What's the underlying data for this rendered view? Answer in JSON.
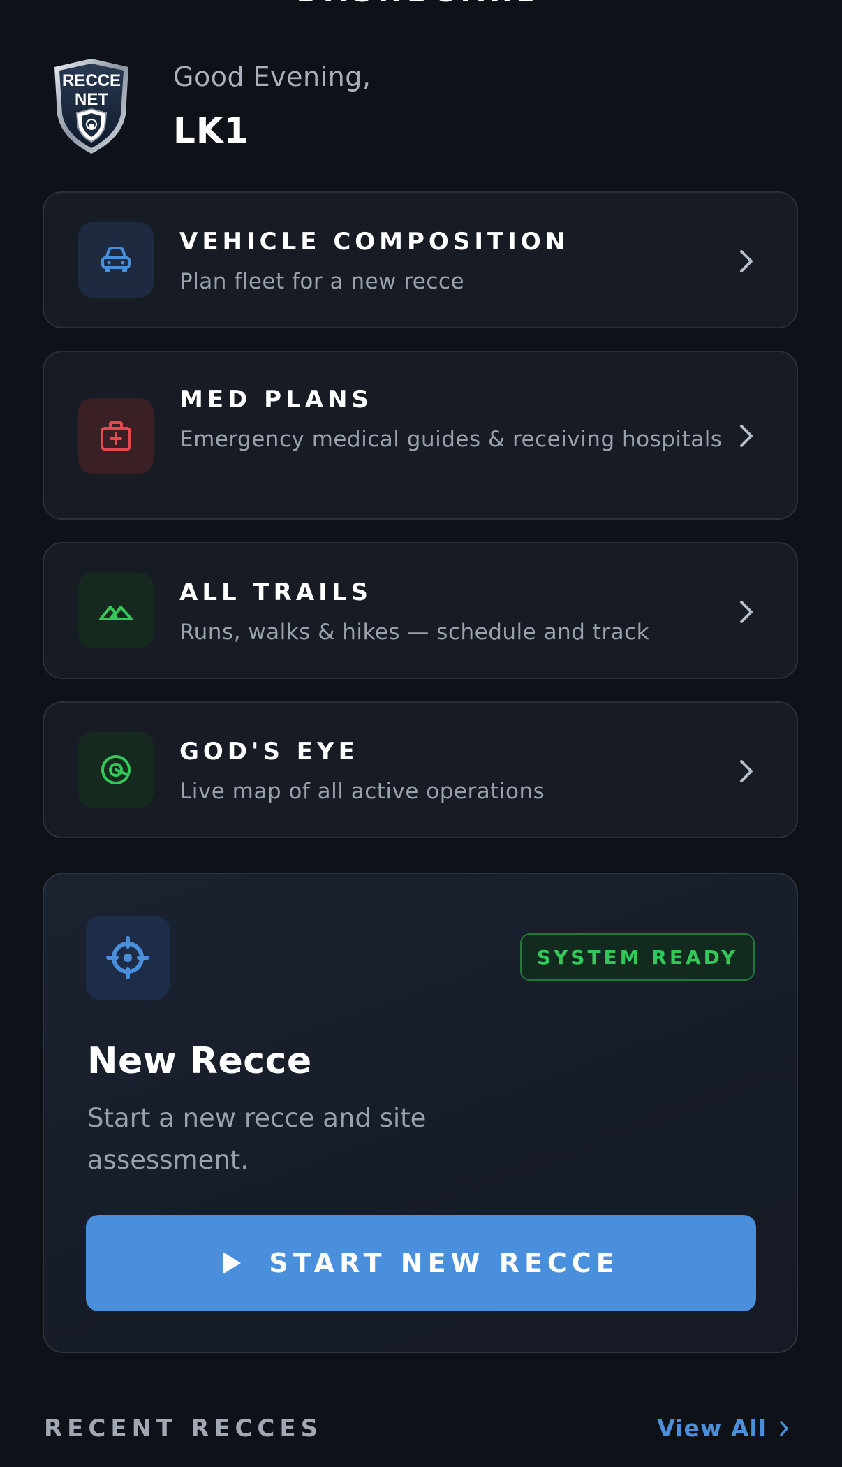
{
  "header": {
    "title": "DASHBOARD"
  },
  "greeting": {
    "salutation": "Good Evening,",
    "username": "LK1",
    "logo_text_line1": "RECCE",
    "logo_text_line2": "NET"
  },
  "menu": [
    {
      "title": "VEHICLE COMPOSITION",
      "subtitle": "Plan fleet for a new recce",
      "icon": "car-icon",
      "icon_color": "#4a8fdb",
      "icon_bg": "#1d2a40"
    },
    {
      "title": "MED PLANS",
      "subtitle": "Emergency medical guides & receiving hospitals",
      "icon": "medical-kit-icon",
      "icon_color": "#e5484d",
      "icon_bg": "#3a1f24"
    },
    {
      "title": "ALL TRAILS",
      "subtitle": "Runs, walks & hikes — schedule and track",
      "icon": "mountain-icon",
      "icon_color": "#34c75a",
      "icon_bg": "#16291f"
    },
    {
      "title": "GOD'S EYE",
      "subtitle": "Live map of all active operations",
      "icon": "radar-target-icon",
      "icon_color": "#34c75a",
      "icon_bg": "#16291f"
    }
  ],
  "new_recce": {
    "icon": "crosshair-icon",
    "status": "SYSTEM READY",
    "title": "New Recce",
    "description": "Start a new recce and site assessment.",
    "button_label": "START NEW RECCE"
  },
  "recent": {
    "title": "RECENT RECCES",
    "view_all_label": "View All"
  },
  "colors": {
    "background": "#0e1118",
    "card": "#161b24",
    "accent": "#4a8fdb",
    "success": "#34c75a"
  }
}
